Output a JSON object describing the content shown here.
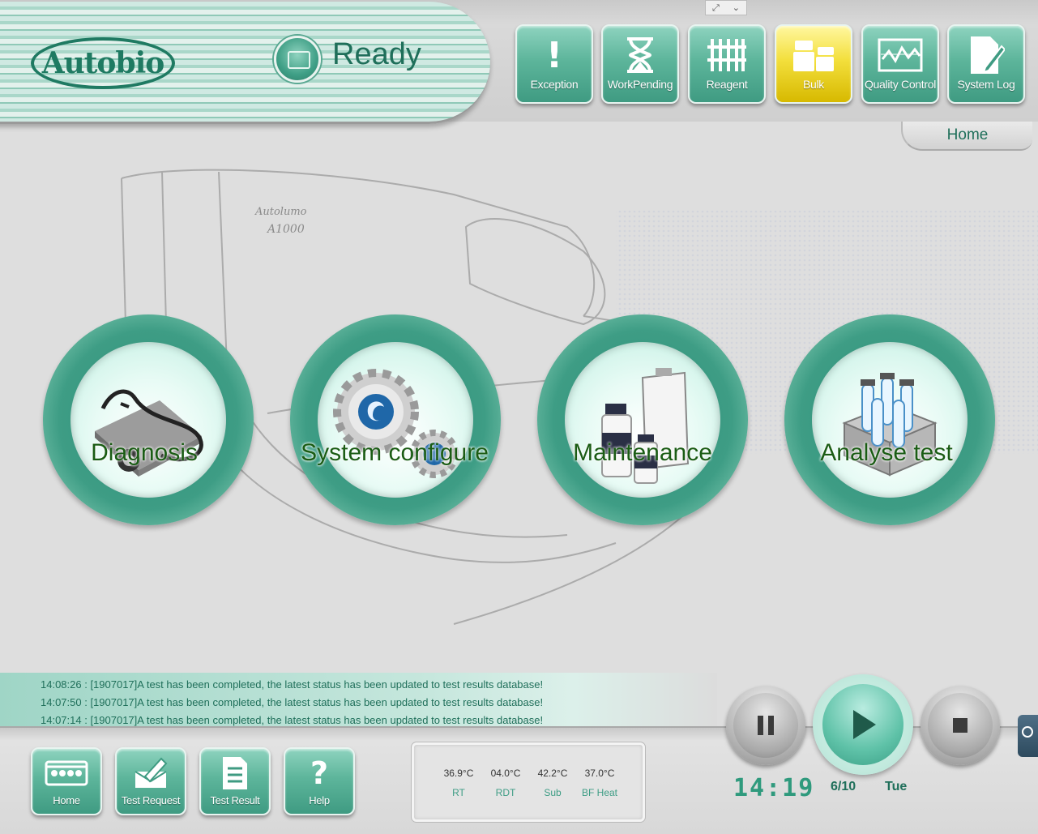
{
  "app": {
    "logo_text": "Autobio",
    "status": "Ready",
    "current_page": "Home"
  },
  "toolbar": [
    {
      "label": "Exception",
      "icon": "exclamation-icon"
    },
    {
      "label": "WorkPending",
      "icon": "hourglass-icon"
    },
    {
      "label": "Reagent",
      "icon": "reagent-rack-icon"
    },
    {
      "label": "Bulk",
      "icon": "bulk-bottles-icon",
      "active": true
    },
    {
      "label": "Quality Control",
      "icon": "qc-chart-icon"
    },
    {
      "label": "System Log",
      "icon": "log-document-icon"
    }
  ],
  "instrument_sketch": {
    "brand": "Autolumo",
    "model": "A1000"
  },
  "modules": [
    {
      "label": "Diagnosis",
      "icon": "stethoscope-icon"
    },
    {
      "label": "System configure",
      "icon": "gears-icon"
    },
    {
      "label": "Maintenance",
      "icon": "bottles-clipboard-icon"
    },
    {
      "label": "Analyse test",
      "icon": "test-tube-rack-icon"
    }
  ],
  "log": [
    "14:08:26 : [1907017]A test has been completed, the latest status has been updated to test results database!",
    "14:07:50 : [1907017]A test has been completed, the latest status has been updated to test results database!",
    "14:07:14 : [1907017]A test has been completed, the latest status has been updated to test results database!"
  ],
  "bottom_nav": [
    {
      "label": "Home",
      "icon": "home-grid-icon"
    },
    {
      "label": "Test Request",
      "icon": "envelope-pen-icon"
    },
    {
      "label": "Test Result",
      "icon": "document-icon"
    },
    {
      "label": "Help",
      "icon": "question-icon"
    }
  ],
  "temperatures": [
    {
      "value": "36.9°C",
      "name": "RT"
    },
    {
      "value": "04.0°C",
      "name": "RDT"
    },
    {
      "value": "42.2°C",
      "name": "Sub"
    },
    {
      "value": "37.0°C",
      "name": "BF Heat"
    }
  ],
  "clock": {
    "time": "14:19",
    "date": "6/10",
    "day": "Tue"
  },
  "colors": {
    "accent": "#3e9d85",
    "active": "#f3df3c",
    "label_text": "#1a5c14"
  }
}
